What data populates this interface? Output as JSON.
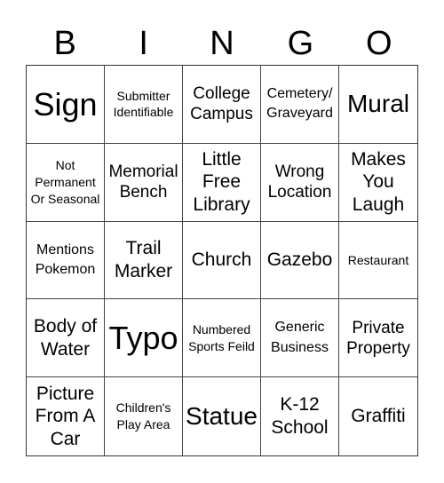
{
  "header": {
    "letters": [
      "B",
      "I",
      "N",
      "G",
      "O"
    ]
  },
  "cells": [
    [
      "Sign",
      "Submitter Identifiable",
      "College Campus",
      "Cemetery/ Graveyard",
      "Mural"
    ],
    [
      "Not Permanent Or Seasonal",
      "Memorial Bench",
      "Little Free Library",
      "Wrong Location",
      "Makes You Laugh"
    ],
    [
      "Mentions Pokemon",
      "Trail Marker",
      "Church",
      "Gazebo",
      "Restaurant"
    ],
    [
      "Body of Water",
      "Typo",
      "Numbered Sports Feild",
      "Generic Business",
      "Private Property"
    ],
    [
      "Picture From A Car",
      "Children's Play Area",
      "Statue",
      "K-12 School",
      "Graffiti"
    ]
  ]
}
